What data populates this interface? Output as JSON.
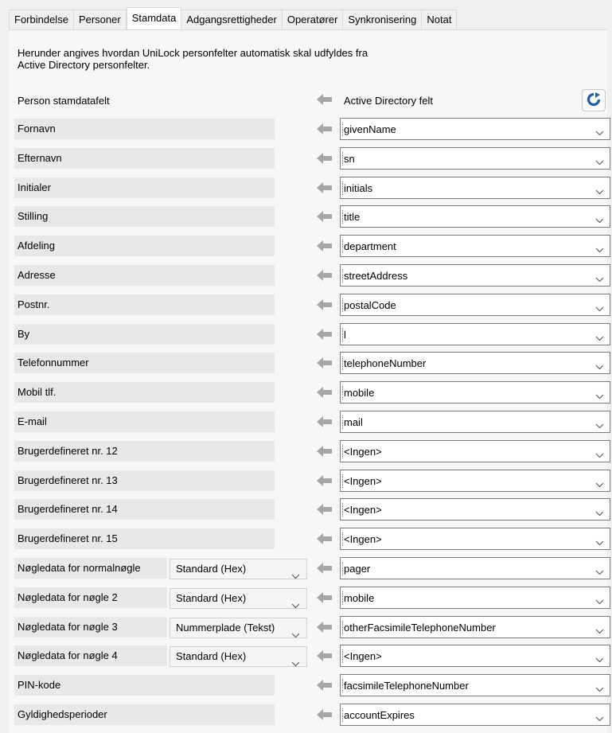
{
  "tabs": [
    "Forbindelse",
    "Personer",
    "Stamdata",
    "Adgangsrettigheder",
    "Operatører",
    "Synkronisering",
    "Notat"
  ],
  "active_tab": "Stamdata",
  "intro": {
    "line1": "Herunder angives hvordan UniLock personfelter automatisk skal udfyldes fra",
    "line2": "Active Directory personfelter."
  },
  "header": {
    "left": "Person stamdatafelt",
    "right": "Active Directory felt"
  },
  "rows": [
    {
      "label": "Fornavn",
      "ad": "givenName"
    },
    {
      "label": "Efternavn",
      "ad": "sn"
    },
    {
      "label": "Initialer",
      "ad": "initials"
    },
    {
      "label": "Stilling",
      "ad": "title"
    },
    {
      "label": "Afdeling",
      "ad": "department"
    },
    {
      "label": "Adresse",
      "ad": "streetAddress"
    },
    {
      "label": "Postnr.",
      "ad": "postalCode"
    },
    {
      "label": "By",
      "ad": "l"
    },
    {
      "label": "Telefonnummer",
      "ad": "telephoneNumber"
    },
    {
      "label": "Mobil tlf.",
      "ad": "mobile"
    },
    {
      "label": "E-mail",
      "ad": "mail"
    },
    {
      "label": "Brugerdefineret nr. 12",
      "ad": "<Ingen>"
    },
    {
      "label": "Brugerdefineret nr. 13",
      "ad": "<Ingen>"
    },
    {
      "label": "Brugerdefineret nr. 14",
      "ad": "<Ingen>"
    },
    {
      "label": "Brugerdefineret nr. 15",
      "ad": "<Ingen>"
    },
    {
      "label": "Nøgledata for normalnøgle",
      "format": "Standard (Hex)",
      "ad": "pager"
    },
    {
      "label": "Nøgledata for nøgle 2",
      "format": "Standard (Hex)",
      "ad": "mobile"
    },
    {
      "label": "Nøgledata for nøgle 3",
      "format": "Nummerplade (Tekst)",
      "ad": "otherFacsimileTelephoneNumber"
    },
    {
      "label": "Nøgledata for nøgle 4",
      "format": "Standard (Hex)",
      "ad": "<Ingen>"
    },
    {
      "label": "PIN-kode",
      "ad": "facsimileTelephoneNumber"
    },
    {
      "label": "Gyldighedsperioder",
      "ad": "accountExpires"
    }
  ],
  "icons": {
    "arrow": "arrow-left-icon",
    "refresh": "refresh-icon",
    "dropdown": "chevron-down-icon"
  },
  "colors": {
    "refresh_icon": "#1f5fa3",
    "arrow": "#a6a6a6"
  }
}
